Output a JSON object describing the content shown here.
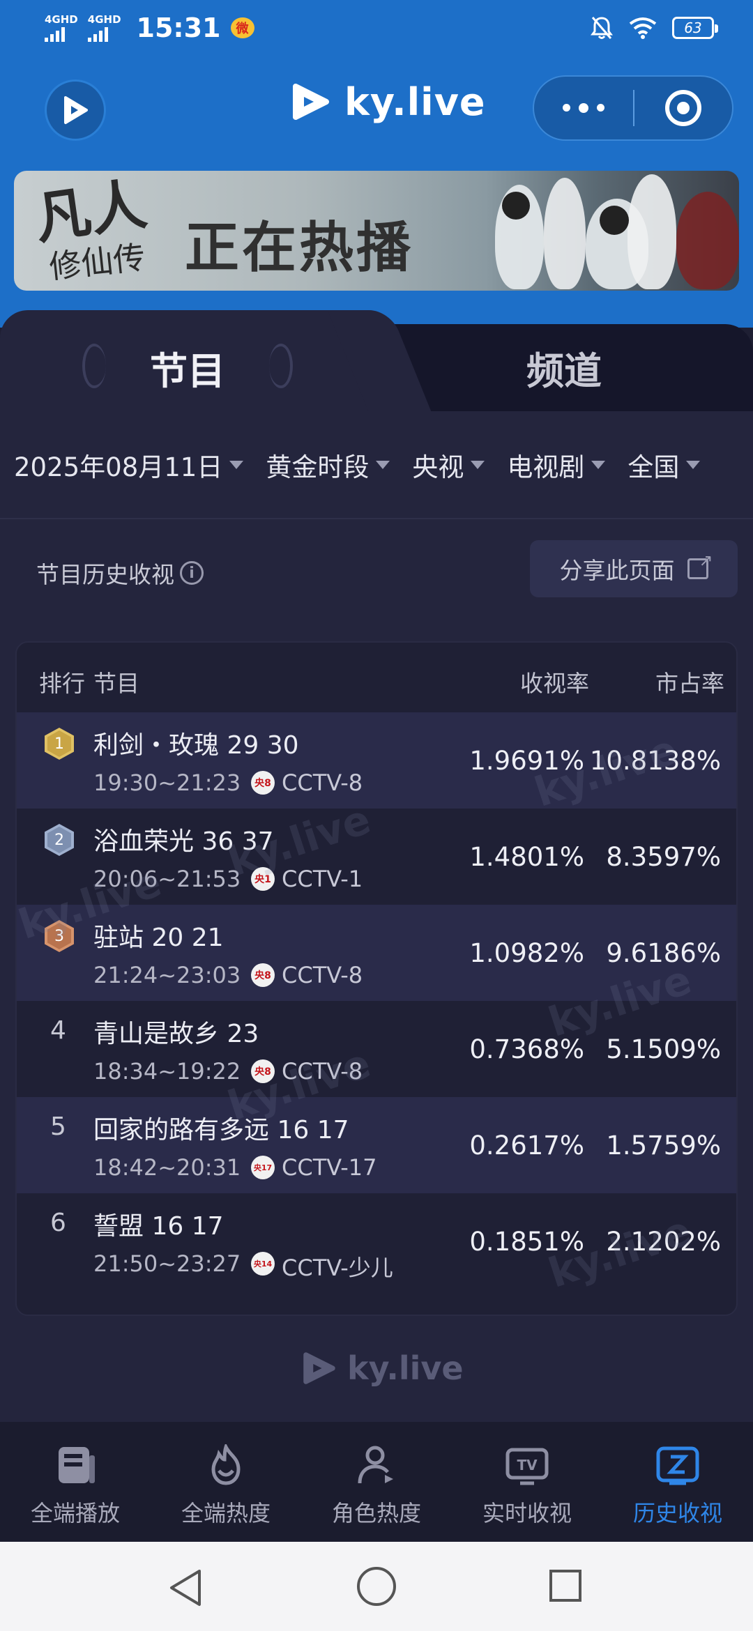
{
  "status_bar": {
    "sim1": "4GHD",
    "sim2": "4GHD",
    "time": "15:31",
    "weibo": "微",
    "battery": "63"
  },
  "app": {
    "brand": "ky.live"
  },
  "banner": {
    "calligraphy_1": "凡人",
    "calligraphy_2": "修仙传",
    "text": "正在热播"
  },
  "tabs": [
    {
      "label": "节目",
      "active": true
    },
    {
      "label": "频道",
      "active": false
    }
  ],
  "filters": [
    {
      "label": "2025年08月11日"
    },
    {
      "label": "黄金时段"
    },
    {
      "label": "央视"
    },
    {
      "label": "电视剧"
    },
    {
      "label": "全国"
    }
  ],
  "section": {
    "title": "节目历史收视",
    "info": "i",
    "share_label": "分享此页面"
  },
  "table": {
    "headers": {
      "rank": "排行",
      "program": "节目",
      "rating": "收视率",
      "share": "市占率"
    },
    "rows": [
      {
        "rank": "1",
        "title": "利剑・玫瑰 29 30",
        "time": "19:30~21:23",
        "ch_logo": "央8",
        "channel": "CCTV-8",
        "rating": "1.9691%",
        "share": "10.8138%"
      },
      {
        "rank": "2",
        "title": "浴血荣光 36 37",
        "time": "20:06~21:53",
        "ch_logo": "央1",
        "channel": "CCTV-1",
        "rating": "1.4801%",
        "share": "8.3597%"
      },
      {
        "rank": "3",
        "title": "驻站 20 21",
        "time": "21:24~23:03",
        "ch_logo": "央8",
        "channel": "CCTV-8",
        "rating": "1.0982%",
        "share": "9.6186%"
      },
      {
        "rank": "4",
        "title": "青山是故乡 23",
        "time": "18:34~19:22",
        "ch_logo": "央8",
        "channel": "CCTV-8",
        "rating": "0.7368%",
        "share": "5.1509%"
      },
      {
        "rank": "5",
        "title": "回家的路有多远 16 17",
        "time": "18:42~20:31",
        "ch_logo": "央17",
        "channel": "CCTV-17",
        "rating": "0.2617%",
        "share": "1.5759%"
      },
      {
        "rank": "6",
        "title": "誓盟 16 17",
        "time": "21:50~23:27",
        "ch_logo": "央14",
        "channel": "CCTV-少儿",
        "rating": "0.1851%",
        "share": "2.1202%"
      }
    ]
  },
  "bottom_nav": [
    {
      "label": "全端播放",
      "icon": "book-icon",
      "active": false
    },
    {
      "label": "全端热度",
      "icon": "flame-icon",
      "active": false
    },
    {
      "label": "角色热度",
      "icon": "person-icon",
      "active": false
    },
    {
      "label": "实时收视",
      "icon": "tv-icon",
      "active": false
    },
    {
      "label": "历史收视",
      "icon": "history-icon",
      "active": true
    }
  ],
  "colors": {
    "header_blue": "#1d6fc8",
    "background": "#24253d",
    "active_nav": "#2f86e8",
    "gold": "#c9a545",
    "silver": "#7d8fb0",
    "bronze": "#b8734e"
  }
}
